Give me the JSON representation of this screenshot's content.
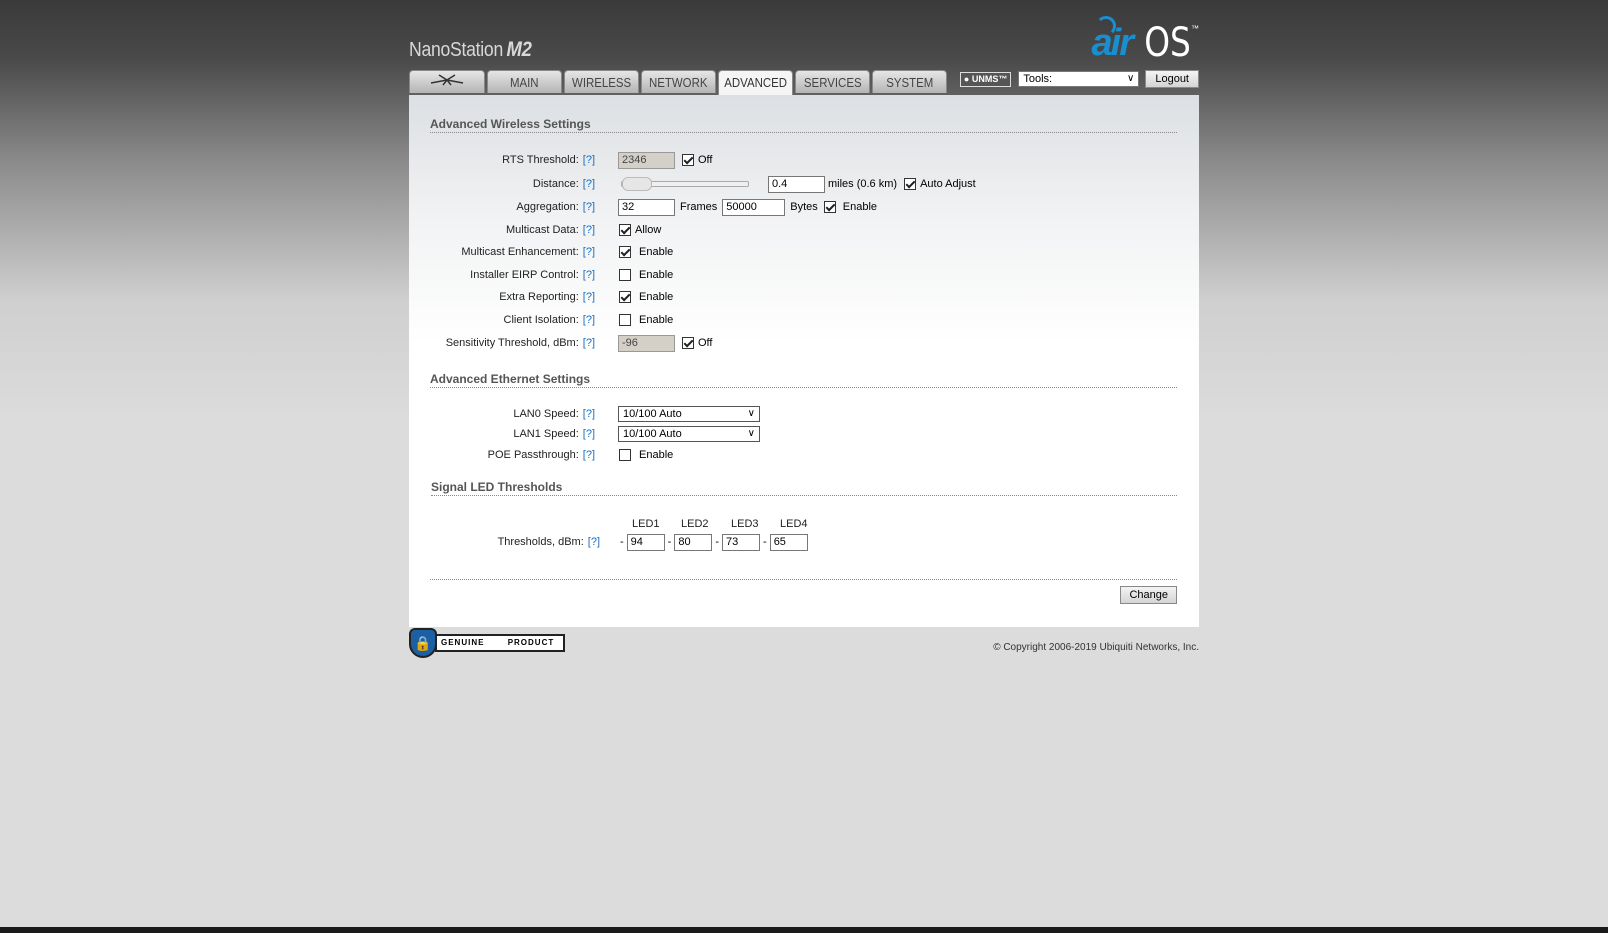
{
  "header": {
    "product": "NanoStation",
    "model": "M2",
    "logo_air": "air",
    "logo_os": "OS",
    "logo_tm": "™"
  },
  "tabs": [
    {
      "label": "",
      "icon": "ubiquiti-logo-icon"
    },
    {
      "label": "MAIN"
    },
    {
      "label": "WIRELESS"
    },
    {
      "label": "NETWORK"
    },
    {
      "label": "ADVANCED"
    },
    {
      "label": "SERVICES"
    },
    {
      "label": "SYSTEM"
    }
  ],
  "toolbar": {
    "unms": "UNMS",
    "tools_value": "Tools:",
    "logout": "Logout"
  },
  "wireless": {
    "title": "Advanced Wireless Settings",
    "help": "[?]",
    "rts_label": "RTS Threshold:",
    "rts_value": "2346",
    "rts_off": "Off",
    "distance_label": "Distance:",
    "distance_value": "0.4",
    "distance_unit": "miles (0.6 km)",
    "auto_adjust": "Auto Adjust",
    "aggregation_label": "Aggregation:",
    "agg_frames_value": "32",
    "frames": "Frames",
    "agg_bytes_value": "50000",
    "bytes": "Bytes",
    "enable": "Enable",
    "multicast_label": "Multicast Data:",
    "allow": "Allow",
    "mcast_enh_label": "Multicast Enhancement:",
    "eirp_label": "Installer EIRP Control:",
    "extra_label": "Extra Reporting:",
    "isolation_label": "Client Isolation:",
    "sensitivity_label": "Sensitivity Threshold, dBm:",
    "sensitivity_value": "-96",
    "sens_off": "Off"
  },
  "ethernet": {
    "title": "Advanced Ethernet Settings",
    "lan0_label": "LAN0 Speed:",
    "lan0_value": "10/100 Auto",
    "lan1_label": "LAN1 Speed:",
    "lan1_value": "10/100 Auto",
    "poe_label": "POE Passthrough:",
    "enable": "Enable"
  },
  "led": {
    "title": "Signal LED Thresholds",
    "headers": [
      "LED1",
      "LED2",
      "LED3",
      "LED4"
    ],
    "label": "Thresholds, dBm:",
    "dash": "-",
    "values": [
      "94",
      "80",
      "73",
      "65"
    ]
  },
  "actions": {
    "change": "Change"
  },
  "footer": {
    "genuine": "GENUINE",
    "product": "PRODUCT",
    "copyright": "© Copyright 2006-2019 Ubiquiti Networks, Inc."
  }
}
